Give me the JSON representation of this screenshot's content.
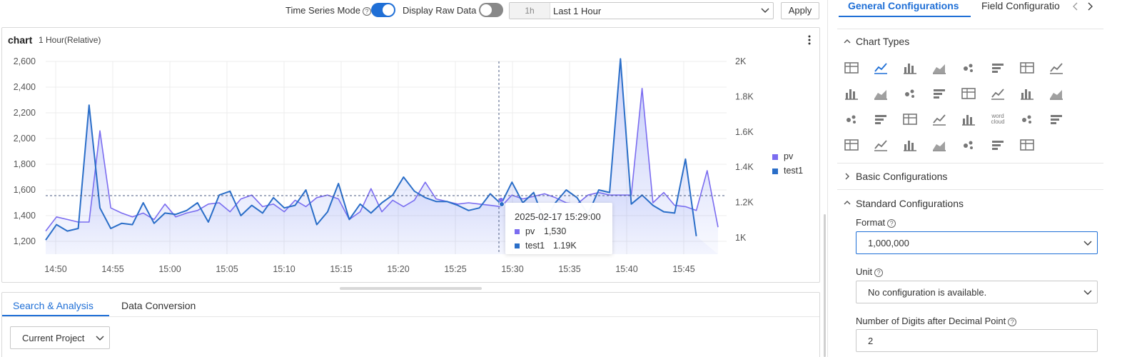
{
  "toolbar": {
    "time_series_mode_label": "Time Series Mode",
    "display_raw_data_label": "Display Raw Data",
    "time_short": "1h",
    "time_range": "Last 1 Hour",
    "apply_label": "Apply",
    "time_series_mode_on": true,
    "display_raw_data_on": false
  },
  "chart_panel": {
    "title": "chart",
    "subtitle": "1 Hour(Relative)",
    "tooltip": {
      "time": "2025-02-17 15:29:00",
      "rows": [
        {
          "name": "pv",
          "value": "1,530",
          "color": "#7b6cf0"
        },
        {
          "name": "test1",
          "value": "1.19K",
          "color": "#2a6ec8"
        }
      ]
    }
  },
  "chart_data": {
    "type": "area",
    "x": [
      "14:50",
      "14:55",
      "15:00",
      "15:05",
      "15:10",
      "15:15",
      "15:20",
      "15:25",
      "15:30",
      "15:35",
      "15:40",
      "15:45"
    ],
    "x_start_minute": 0,
    "left_axis": {
      "ticks": [
        "1,200",
        "1,400",
        "1,600",
        "1,800",
        "2,000",
        "2,200",
        "2,400",
        "2,600"
      ],
      "ylim": [
        1100,
        2600
      ]
    },
    "right_axis": {
      "ticks": [
        "1K",
        "1.2K",
        "1.4K",
        "1.6K",
        "1.8K",
        "2K"
      ],
      "ylim": [
        960,
        2000
      ]
    },
    "legend": [
      "pv",
      "test1"
    ],
    "legend_position": "right",
    "colors": {
      "pv": "#7b6cf0",
      "test1": "#2a6ec8"
    },
    "series": [
      {
        "name": "pv",
        "axis": "left",
        "values": [
          1280,
          1390,
          1370,
          1350,
          1350,
          2060,
          1460,
          1420,
          1390,
          1420,
          1370,
          1490,
          1390,
          1420,
          1440,
          1490,
          1500,
          1430,
          1530,
          1560,
          1470,
          1490,
          1430,
          1520,
          1470,
          1540,
          1560,
          1530,
          1370,
          1430,
          1610,
          1430,
          1520,
          1470,
          1520,
          1660,
          1530,
          1510,
          1490,
          1500,
          1490,
          1480,
          1470,
          1560,
          1530,
          1550,
          1570,
          1540,
          1500,
          1490,
          1560,
          1580,
          1560,
          1560,
          1560,
          2390,
          1500,
          1580,
          1480,
          1470,
          1440,
          1750,
          1310
        ]
      },
      {
        "name": "test1",
        "axis": "left",
        "values": [
          1210,
          1330,
          1280,
          1300,
          2260,
          1460,
          1300,
          1340,
          1330,
          1500,
          1340,
          1420,
          1410,
          1440,
          1500,
          1350,
          1560,
          1590,
          1400,
          1480,
          1420,
          1540,
          1460,
          1480,
          1600,
          1330,
          1430,
          1650,
          1370,
          1490,
          1420,
          1500,
          1560,
          1700,
          1590,
          1540,
          1510,
          1510,
          1480,
          1440,
          1460,
          1570,
          1490,
          1660,
          1500,
          1580,
          1350,
          1500,
          1600,
          1540,
          1410,
          1600,
          1580,
          2620,
          1490,
          1560,
          1480,
          1430,
          1420,
          1840,
          1240
        ]
      }
    ]
  },
  "bottom_panel": {
    "tabs": [
      "Search & Analysis",
      "Data Conversion"
    ],
    "active_tab": 0,
    "project_select": "Current Project"
  },
  "right_panel": {
    "tabs": [
      "General Configurations",
      "Field Configuratio"
    ],
    "sections": {
      "chart_types": "Chart Types",
      "basic": "Basic Configurations",
      "standard": "Standard Configurations"
    },
    "fields": {
      "format_label": "Format",
      "format_value": "1,000,000",
      "unit_label": "Unit",
      "unit_value": "No configuration is available.",
      "digits_label": "Number of Digits after Decimal Point",
      "digits_value": "2"
    },
    "chart_type_icons": [
      "table-icon",
      "line-chart-icon",
      "bar-chart-icon",
      "area-chart-icon",
      "single-value-icon",
      "scatter-icon",
      "flow-chart-icon",
      "pie-chart-icon",
      "column-chart-icon",
      "radar-chart-icon",
      "grid-table-icon",
      "dot-matrix-icon",
      "bubble-icon",
      "funnel-table-icon",
      "china-map-icon",
      "world-map-icon",
      "image-chart-icon",
      "markdown-icon",
      "timeline-icon",
      "candlestick-icon",
      "sankey-icon",
      "word-cloud-icon",
      "topology-icon",
      "histogram-icon",
      "amap-icon",
      "cloud-map-icon",
      "location-map-icon",
      "treemap-icon",
      "stacked-bar-icon",
      "funnel-icon",
      "list-icon"
    ],
    "word_cloud_text": "word cloud"
  }
}
